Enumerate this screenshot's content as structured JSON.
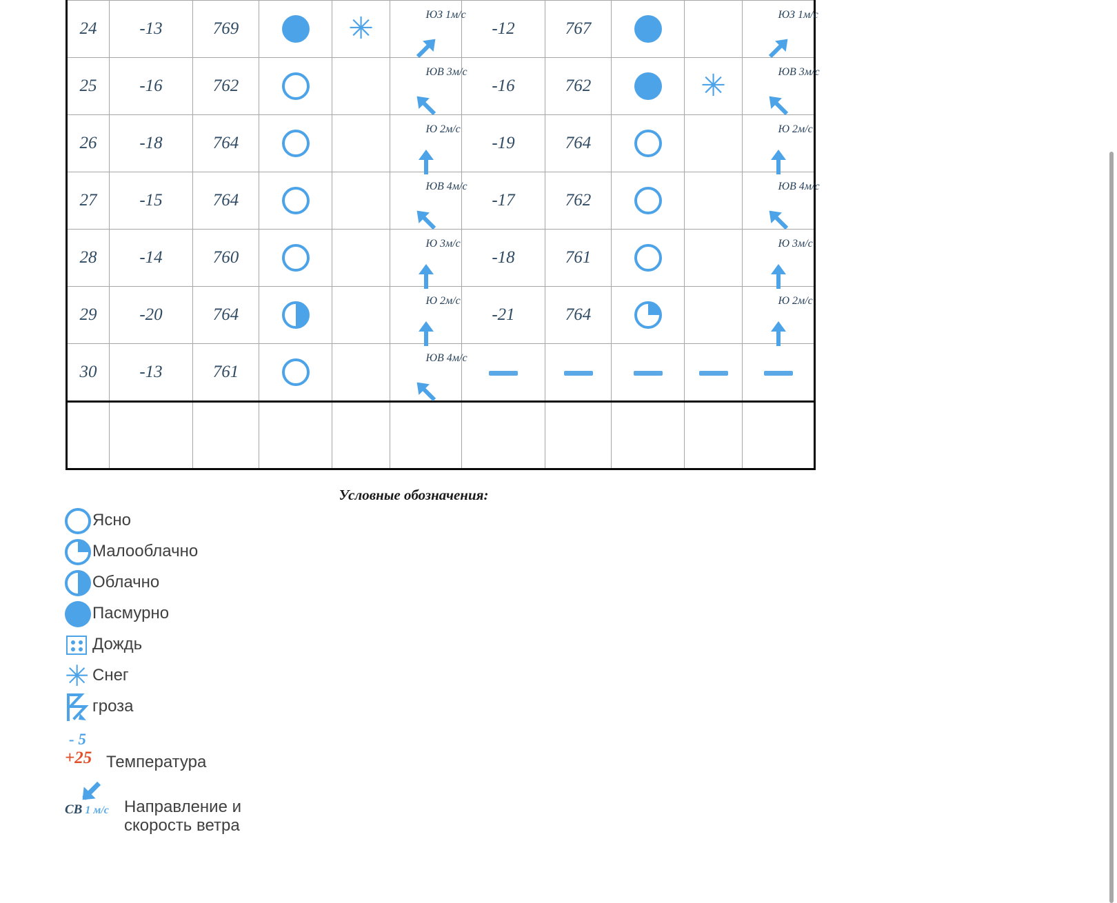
{
  "table": {
    "columns": [
      {
        "key": "day",
        "name": "day-number"
      },
      {
        "key": "temp_day",
        "name": "daytime-temperature"
      },
      {
        "key": "pressure_day",
        "name": "daytime-pressure"
      },
      {
        "key": "cloud_day",
        "name": "daytime-cloudiness"
      },
      {
        "key": "phen_day",
        "name": "daytime-phenomena"
      },
      {
        "key": "wind_day",
        "name": "daytime-wind"
      },
      {
        "key": "temp_night",
        "name": "nighttime-temperature"
      },
      {
        "key": "pressure_night",
        "name": "nighttime-pressure"
      },
      {
        "key": "cloud_night",
        "name": "nighttime-cloudiness"
      },
      {
        "key": "phen_night",
        "name": "nighttime-phenomena"
      },
      {
        "key": "wind_night",
        "name": "nighttime-wind"
      }
    ],
    "rows": [
      {
        "day": "24",
        "temp_day": "-13",
        "pressure_day": "769",
        "cloud_day": "overcast",
        "phen_day": "snow",
        "wind_day": {
          "dir": "ЮЗ",
          "speed": "1м/с",
          "label": "ЮЗ 1м/с",
          "arrow": "ne"
        },
        "temp_night": "-12",
        "pressure_night": "767",
        "cloud_night": "overcast",
        "phen_night": "",
        "wind_night": {
          "dir": "ЮЗ",
          "speed": "1м/с",
          "label": "ЮЗ 1м/с",
          "arrow": "ne"
        }
      },
      {
        "day": "25",
        "temp_day": "-16",
        "pressure_day": "762",
        "cloud_day": "clear",
        "phen_day": "",
        "wind_day": {
          "dir": "ЮВ",
          "speed": "3м/с",
          "label": "ЮВ 3м/с",
          "arrow": "nw"
        },
        "temp_night": "-16",
        "pressure_night": "762",
        "cloud_night": "overcast",
        "phen_night": "snow",
        "wind_night": {
          "dir": "ЮВ",
          "speed": "3м/с",
          "label": "ЮВ 3м/с",
          "arrow": "nw"
        }
      },
      {
        "day": "26",
        "temp_day": "-18",
        "pressure_day": "764",
        "cloud_day": "clear",
        "phen_day": "",
        "wind_day": {
          "dir": "Ю",
          "speed": "2м/с",
          "label": "Ю 2м/с",
          "arrow": "n"
        },
        "temp_night": "-19",
        "pressure_night": "764",
        "cloud_night": "clear",
        "phen_night": "",
        "wind_night": {
          "dir": "Ю",
          "speed": "2м/с",
          "label": "Ю 2м/с",
          "arrow": "n"
        }
      },
      {
        "day": "27",
        "temp_day": "-15",
        "pressure_day": "764",
        "cloud_day": "clear",
        "phen_day": "",
        "wind_day": {
          "dir": "ЮВ",
          "speed": "4м/с",
          "label": "ЮВ 4м/с",
          "arrow": "nw"
        },
        "temp_night": "-17",
        "pressure_night": "762",
        "cloud_night": "clear",
        "phen_night": "",
        "wind_night": {
          "dir": "ЮВ",
          "speed": "4м/с",
          "label": "ЮВ 4м/с",
          "arrow": "nw"
        }
      },
      {
        "day": "28",
        "temp_day": "-14",
        "pressure_day": "760",
        "cloud_day": "clear",
        "phen_day": "",
        "wind_day": {
          "dir": "Ю",
          "speed": "3м/с",
          "label": "Ю 3м/с",
          "arrow": "n"
        },
        "temp_night": "-18",
        "pressure_night": "761",
        "cloud_night": "clear",
        "phen_night": "",
        "wind_night": {
          "dir": "Ю",
          "speed": "3м/с",
          "label": "Ю 3м/с",
          "arrow": "n"
        }
      },
      {
        "day": "29",
        "temp_day": "-20",
        "pressure_day": "764",
        "cloud_day": "cloudy",
        "phen_day": "",
        "wind_day": {
          "dir": "Ю",
          "speed": "2м/с",
          "label": "Ю 2м/с",
          "arrow": "n"
        },
        "temp_night": "-21",
        "pressure_night": "764",
        "cloud_night": "partly",
        "phen_night": "",
        "wind_night": {
          "dir": "Ю",
          "speed": "2м/с",
          "label": "Ю 2м/с",
          "arrow": "n"
        }
      },
      {
        "day": "30",
        "temp_day": "-13",
        "pressure_day": "761",
        "cloud_day": "clear",
        "phen_day": "",
        "wind_day": {
          "dir": "ЮВ",
          "speed": "4м/с",
          "label": "ЮВ 4м/с",
          "arrow": "nw"
        },
        "temp_night": "dash",
        "pressure_night": "dash",
        "cloud_night": "dash",
        "phen_night": "dash",
        "wind_night": {
          "dir": "",
          "speed": "",
          "label": "dash",
          "arrow": "dash"
        }
      }
    ]
  },
  "legend": {
    "title": "Условные обозначения:",
    "items": [
      {
        "icon": "clear-circle-icon",
        "label": "Ясно"
      },
      {
        "icon": "partly-cloudy-icon",
        "label": "Малооблачно"
      },
      {
        "icon": "cloudy-icon",
        "label": "Облачно"
      },
      {
        "icon": "overcast-icon",
        "label": "Пасмурно"
      },
      {
        "icon": "rain-icon",
        "label": "Дождь"
      },
      {
        "icon": "snow-icon",
        "label": "Снег"
      },
      {
        "icon": "thunderstorm-icon",
        "label": "гроза"
      }
    ],
    "temperature": {
      "cold_value": "- 5",
      "warm_value": "+25",
      "label": "Температура",
      "cold_color": "#4da3e8",
      "warm_color": "#e0502a"
    },
    "wind": {
      "direction": "СВ",
      "speed": "1 м/с",
      "label_line1": "Направление и",
      "label_line2": "скорость ветра"
    }
  },
  "colors": {
    "accent_blue": "#4da3e8",
    "text_blue": "#2f4a63",
    "grid": "#a6a6a6",
    "outer_border": "#0a0a0a",
    "legend_text": "#3f3f3f"
  },
  "snow_glyph": "✳",
  "scrollbar": {
    "name": "vertical-scrollbar"
  }
}
